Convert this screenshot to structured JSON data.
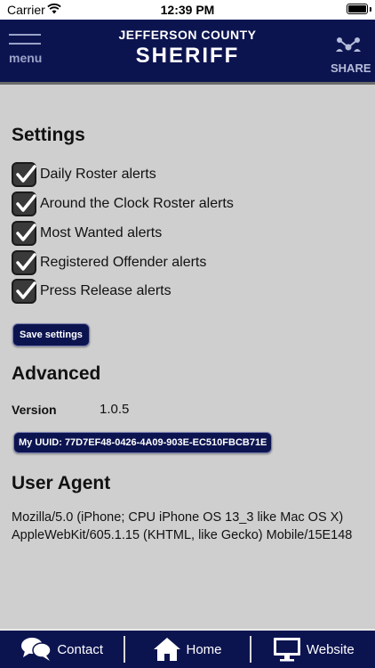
{
  "status_bar": {
    "carrier": "Carrier",
    "time": "12:39 PM"
  },
  "header": {
    "menu_label": "menu",
    "title_line1": "JEFFERSON COUNTY",
    "title_line2": "SHERIFF",
    "share_label": "SHARE"
  },
  "settings": {
    "title": "Settings",
    "alerts": [
      {
        "label": "Daily Roster alerts",
        "checked": true
      },
      {
        "label": "Around the Clock Roster alerts",
        "checked": true
      },
      {
        "label": "Most Wanted alerts",
        "checked": true
      },
      {
        "label": "Registered Offender alerts",
        "checked": true
      },
      {
        "label": "Press Release alerts",
        "checked": true
      }
    ],
    "save_label": "Save settings"
  },
  "advanced": {
    "title": "Advanced",
    "version_label": "Version",
    "version_value": "1.0.5",
    "uuid_label": "My UUID: 77D7EF48-0426-4A09-903E-EC510FBCB71E"
  },
  "user_agent": {
    "title": "User Agent",
    "line1": "Mozilla/5.0 (iPhone; CPU iPhone OS 13_3 like Mac OS X)",
    "line2": "AppleWebKit/605.1.15 (KHTML, like Gecko) Mobile/15E148"
  },
  "footer": {
    "contact_label": "Contact",
    "home_label": "Home",
    "website_label": "Website"
  },
  "colors": {
    "navy": "#0c1450",
    "background": "#cfcfcf"
  }
}
